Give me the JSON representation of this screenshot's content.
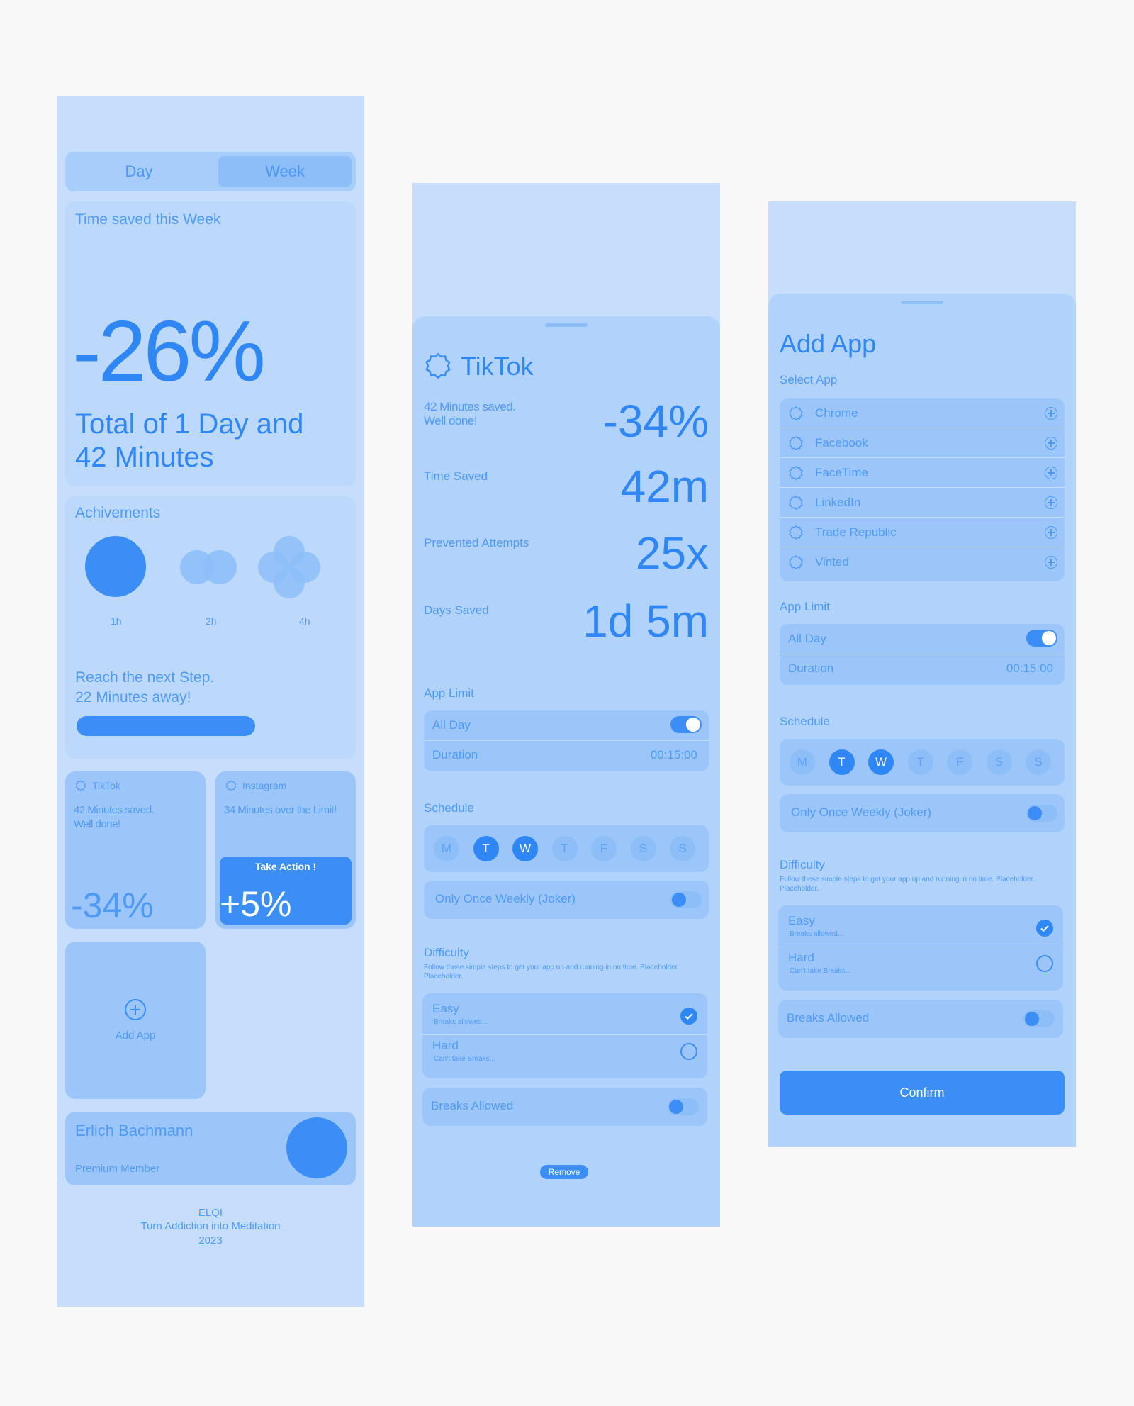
{
  "screen1": {
    "segment": {
      "day": "Day",
      "week": "Week"
    },
    "time_saved": {
      "label": "Time saved this Week",
      "percent": "-26%",
      "total_line1": "Total of 1 Day and",
      "total_line2": "42 Minutes"
    },
    "achievements": {
      "title": "Achivements",
      "items": [
        "1h",
        "2h",
        "4h"
      ],
      "next_line1": "Reach the next Step.",
      "next_line2": "22 Minutes away!",
      "progress": 0.73
    },
    "tiktok_card": {
      "app": "TikTok",
      "line1": "42 Minutes saved.",
      "line2": "Well done!",
      "percent": "-34%"
    },
    "instagram_card": {
      "app": "Instagram",
      "line1": "34 Minutes over the Limit!",
      "action": "Take Action !",
      "percent": "+5%"
    },
    "add_app": "Add App",
    "profile": {
      "name": "Erlich Bachmann",
      "status": "Premium Member"
    },
    "footer": {
      "brand": "ELQI",
      "tagline": "Turn Addiction into Meditation",
      "year": "2023"
    }
  },
  "screen2": {
    "app_title": "TikTok",
    "saved_line1": "42 Minutes saved.",
    "saved_line2": "Well done!",
    "percent": "-34%",
    "stats": [
      {
        "label": "Time Saved",
        "value": "42m"
      },
      {
        "label": "Prevented Attempts",
        "value": "25x"
      },
      {
        "label": "Days Saved",
        "value": "1d 5m"
      }
    ],
    "app_limit": {
      "title": "App Limit",
      "all_day": "All Day",
      "all_day_on": true,
      "duration_label": "Duration",
      "duration_value": "00:15:00"
    },
    "schedule": {
      "title": "Schedule",
      "days": [
        "M",
        "T",
        "W",
        "T",
        "F",
        "S",
        "S"
      ],
      "active": [
        false,
        true,
        true,
        false,
        false,
        false,
        false
      ],
      "joker": "Only Once Weekly (Joker)",
      "joker_on": false
    },
    "difficulty": {
      "title": "Difficulty",
      "desc": "Follow these simple steps to get your app up and running in no time. Placeholder. Placeholder.",
      "options": [
        {
          "label": "Easy",
          "sub": "Breaks allowed...",
          "selected": true
        },
        {
          "label": "Hard",
          "sub": "Can't take Breaks...",
          "selected": false
        }
      ]
    },
    "breaks": {
      "label": "Breaks Allowed",
      "on": false
    },
    "remove": "Remove"
  },
  "screen3": {
    "title": "Add App",
    "select_label": "Select App",
    "apps": [
      "Chrome",
      "Facebook",
      "FaceTime",
      "LinkedIn",
      "Trade Republic",
      "Vinted"
    ],
    "app_limit": {
      "title": "App Limit",
      "all_day": "All Day",
      "all_day_on": true,
      "duration_label": "Duration",
      "duration_value": "00:15:00"
    },
    "schedule": {
      "title": "Schedule",
      "days": [
        "M",
        "T",
        "W",
        "T",
        "F",
        "S",
        "S"
      ],
      "active": [
        false,
        true,
        true,
        false,
        false,
        false,
        false
      ],
      "joker": "Only Once Weekly (Joker)",
      "joker_on": false
    },
    "difficulty": {
      "title": "Difficulty",
      "desc": "Follow these simple steps to get your app up and running in no time. Placeholder. Placeholder.",
      "options": [
        {
          "label": "Easy",
          "sub": "Breaks allowed...",
          "selected": true
        },
        {
          "label": "Hard",
          "sub": "Can't take Breaks...",
          "selected": false
        }
      ]
    },
    "breaks": {
      "label": "Breaks Allowed",
      "on": false
    },
    "confirm": "Confirm"
  },
  "colors": {
    "page_bg": "#f8f8f8",
    "screen_bg": "#c6defb",
    "card_bg": "#b3d4fb",
    "accent": "#2f86f5",
    "text": "#3a8ef5"
  },
  "icons": [
    "badge-icon",
    "plus-circle-icon",
    "check-icon",
    "grab-handle"
  ]
}
